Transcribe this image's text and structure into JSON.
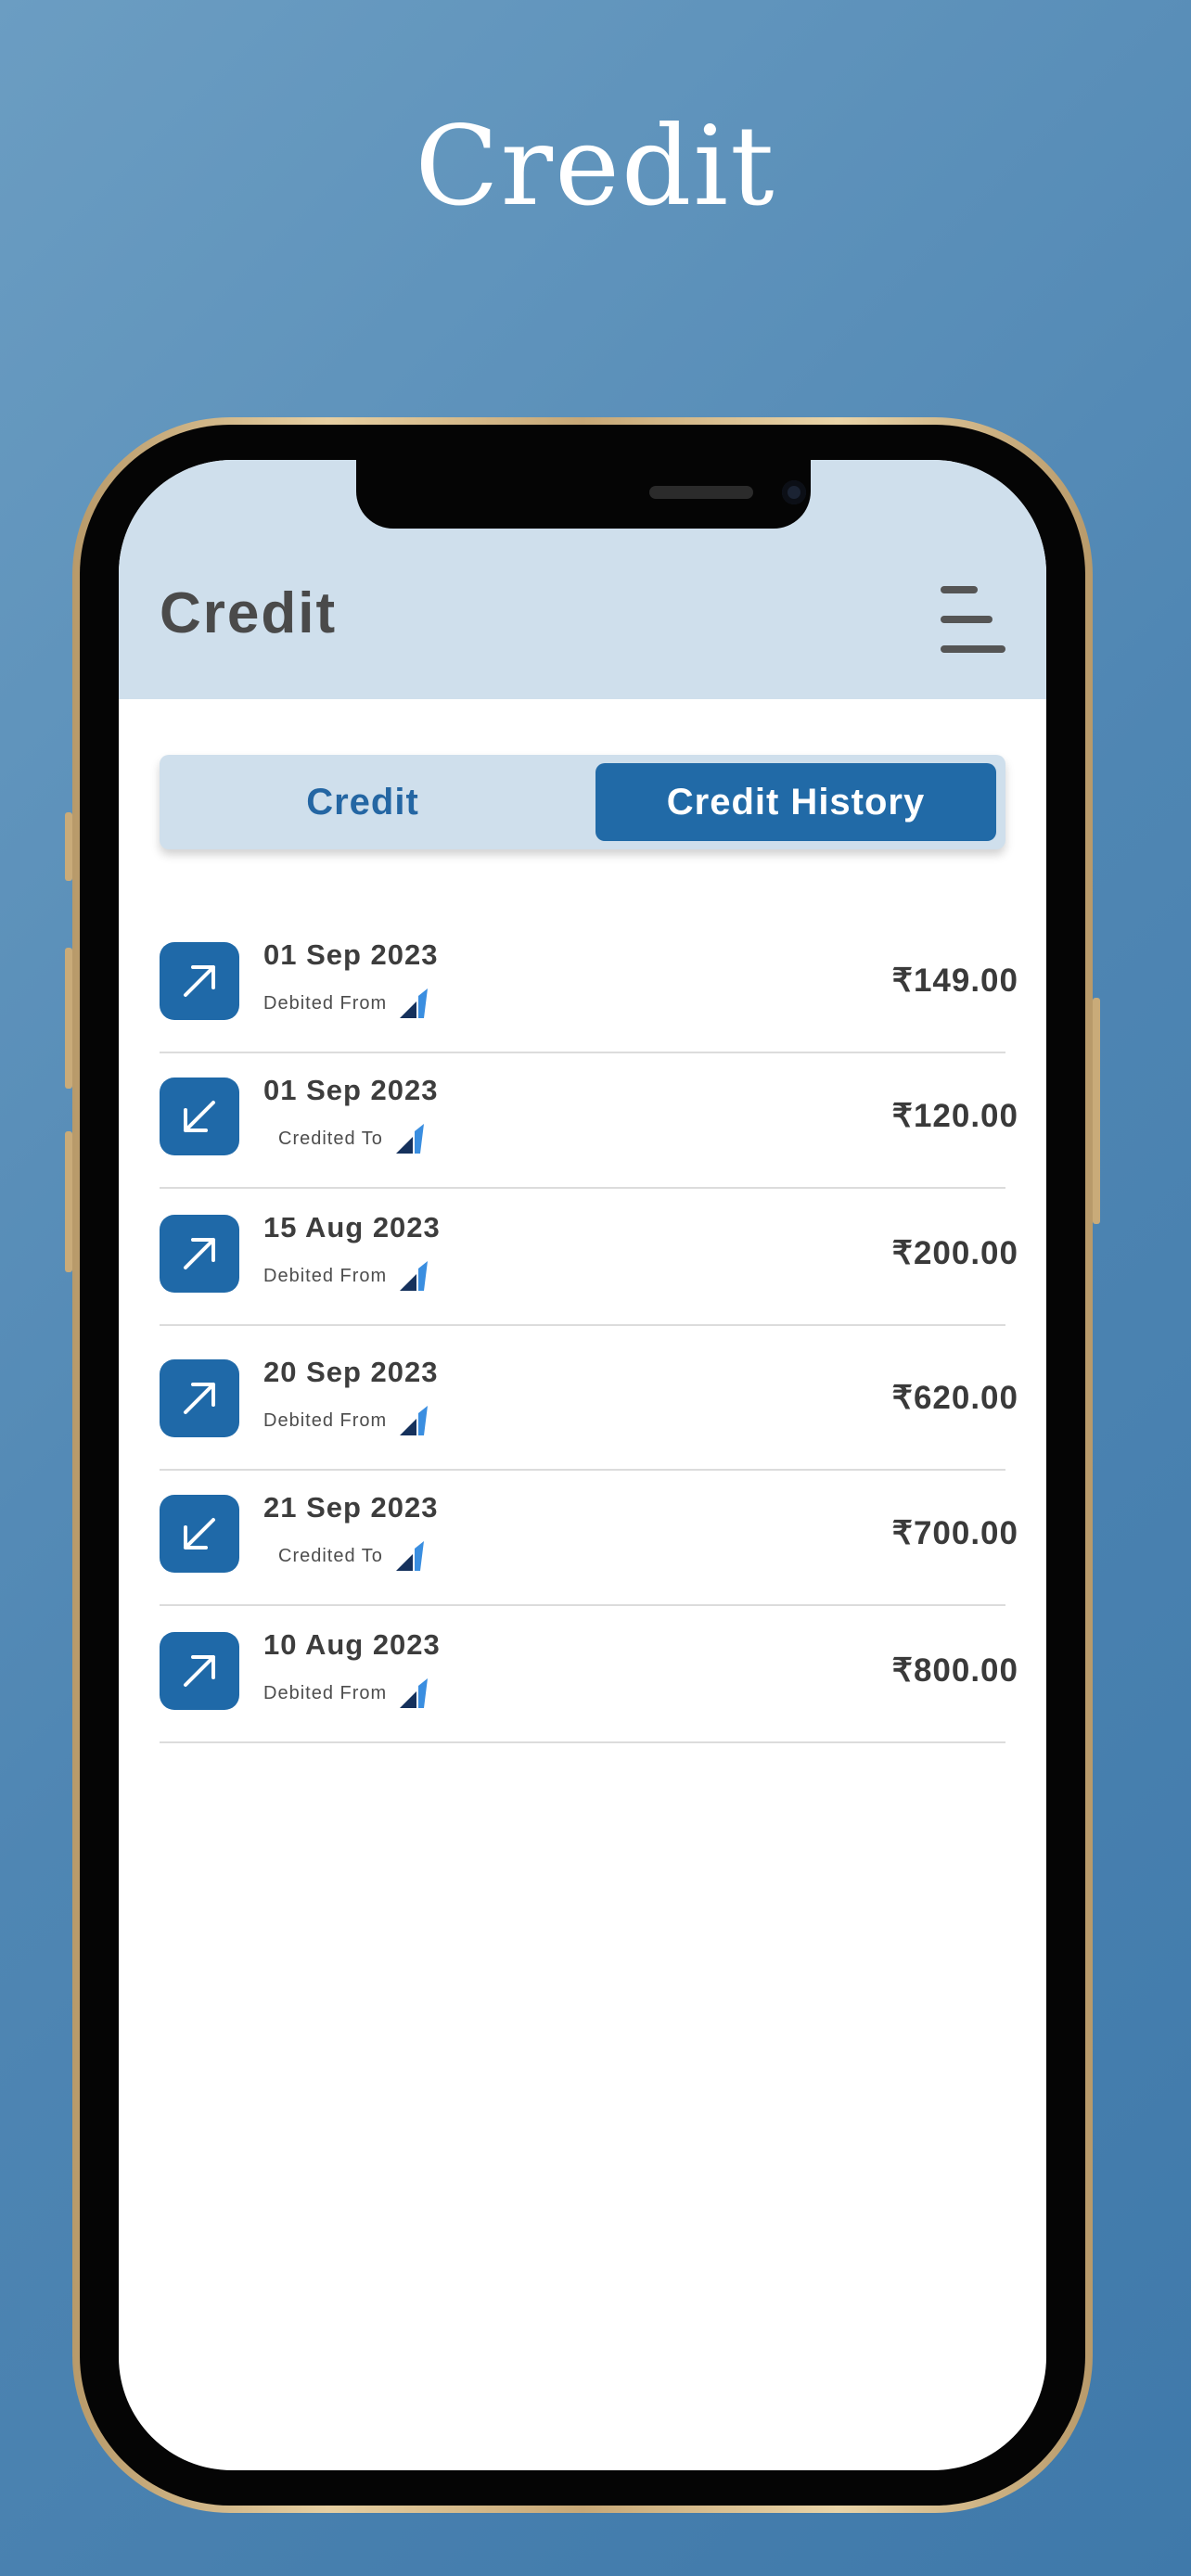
{
  "hero": {
    "title": "Credit"
  },
  "app": {
    "title": "Credit",
    "menu_icon": "hamburger-menu-icon",
    "tabs": [
      {
        "label": "Credit",
        "active": false
      },
      {
        "label": "Credit History",
        "active": true
      }
    ]
  },
  "transactions": [
    {
      "date": "01 Sep 2023",
      "direction": "debit",
      "icon": "arrow-up-right-icon",
      "label": "Debited From",
      "amount": "₹149.00"
    },
    {
      "date": "01 Sep 2023",
      "direction": "credit",
      "icon": "arrow-down-left-icon",
      "label": "Credited To",
      "amount": "₹120.00"
    },
    {
      "date": "15 Aug 2023",
      "direction": "debit",
      "icon": "arrow-up-right-icon",
      "label": "Debited From",
      "amount": "₹200.00"
    },
    {
      "date": "20 Sep 2023",
      "direction": "debit",
      "icon": "arrow-up-right-icon",
      "label": "Debited From",
      "amount": "₹620.00"
    },
    {
      "date": "21 Sep 2023",
      "direction": "credit",
      "icon": "arrow-down-left-icon",
      "label": "Credited To",
      "amount": "₹700.00"
    },
    {
      "date": "10 Aug 2023",
      "direction": "debit",
      "icon": "arrow-up-right-icon",
      "label": "Debited From",
      "amount": "₹800.00"
    }
  ],
  "colors": {
    "accent": "#216aa7",
    "appbar": "#cfdfec",
    "background": "#4f86b3"
  }
}
